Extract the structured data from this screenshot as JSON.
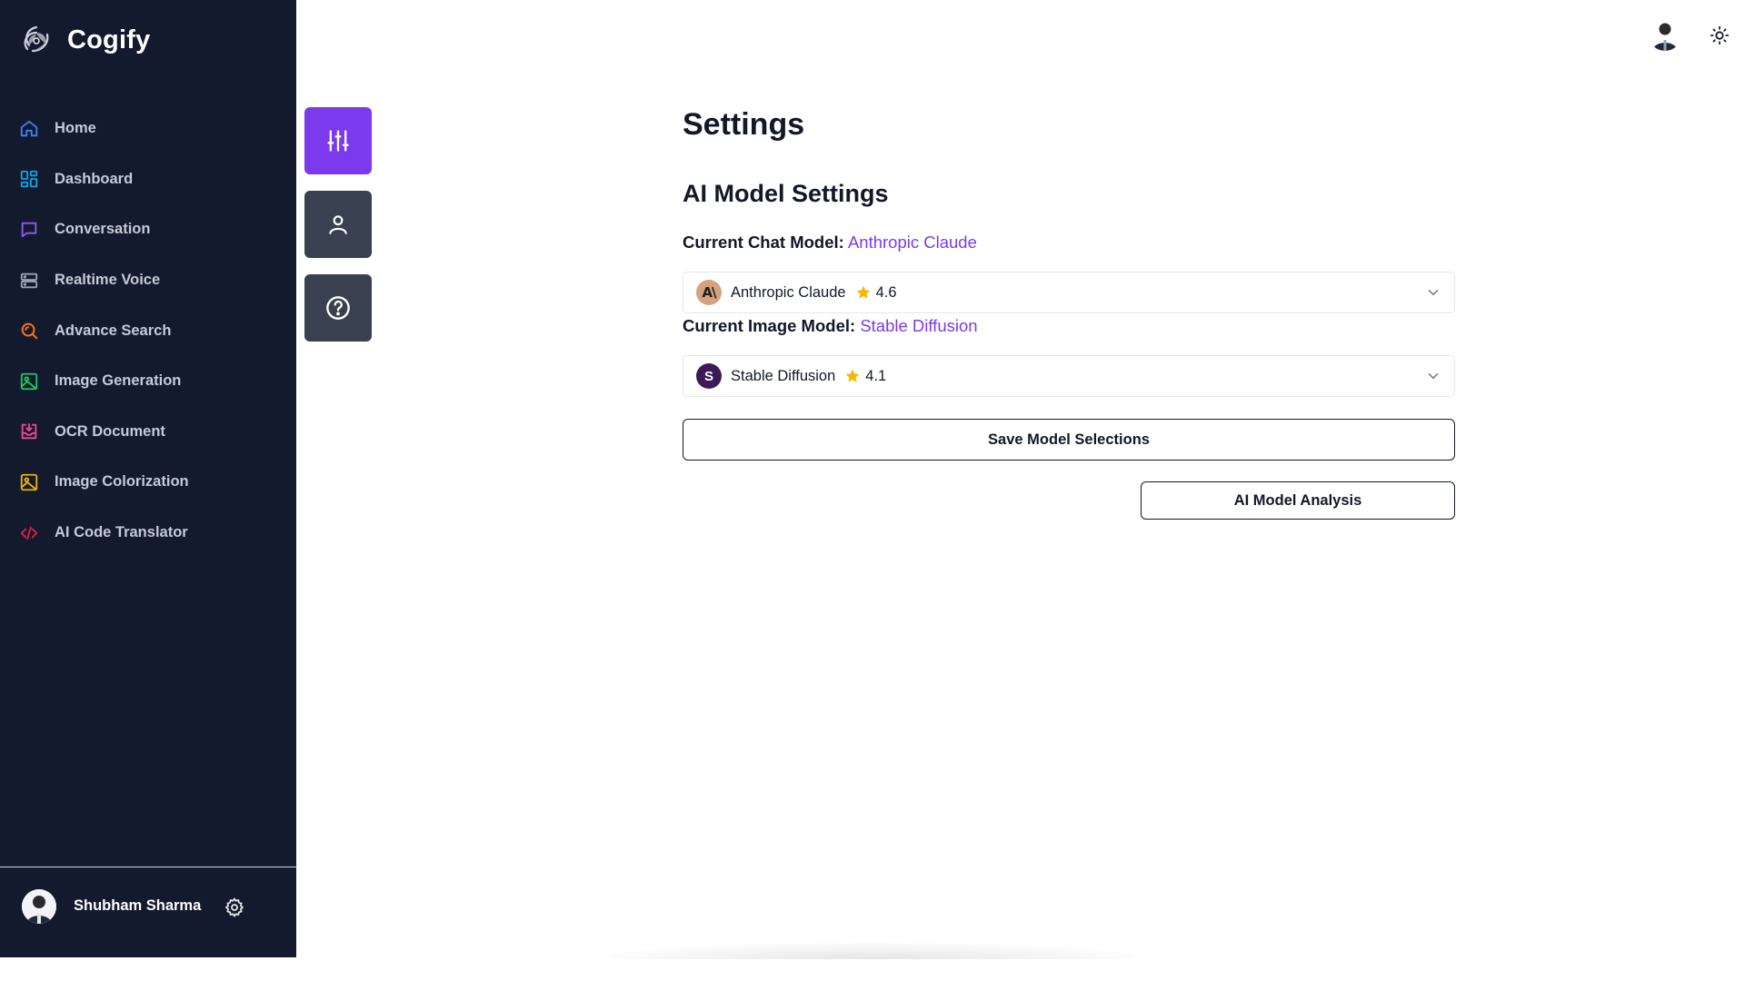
{
  "app": {
    "name": "Cogify"
  },
  "sidebar": {
    "items": [
      {
        "label": "Home",
        "icon": "home-icon",
        "color": "#3b82f6"
      },
      {
        "label": "Dashboard",
        "icon": "dashboard-icon",
        "color": "#0ea5e9"
      },
      {
        "label": "Conversation",
        "icon": "chat-icon",
        "color": "#8b5cf6"
      },
      {
        "label": "Realtime Voice",
        "icon": "server-icon",
        "color": "#9ca3af"
      },
      {
        "label": "Advance Search",
        "icon": "search-icon",
        "color": "#f97316"
      },
      {
        "label": "Image Generation",
        "icon": "image-icon",
        "color": "#22c55e"
      },
      {
        "label": "OCR Document",
        "icon": "download-tray-icon",
        "color": "#ec4899"
      },
      {
        "label": "Image Colorization",
        "icon": "image-icon",
        "color": "#eab308"
      },
      {
        "label": "AI Code Translator",
        "icon": "code-icon",
        "color": "#e11d48"
      }
    ],
    "user": {
      "name": "Shubham Sharma"
    }
  },
  "subnav": [
    {
      "icon": "sliders-icon",
      "active": true
    },
    {
      "icon": "user-icon",
      "active": false
    },
    {
      "icon": "help-circle-icon",
      "active": false
    }
  ],
  "settings": {
    "title": "Settings",
    "section_title": "AI Model Settings",
    "chat_model": {
      "label": "Current Chat Model:",
      "value": "Anthropic Claude",
      "selected": {
        "name": "Anthropic Claude",
        "rating": "4.6",
        "logo_text": "A\\"
      }
    },
    "image_model": {
      "label": "Current Image Model:",
      "value": "Stable Diffusion",
      "selected": {
        "name": "Stable Diffusion",
        "rating": "4.1",
        "logo_text": "S"
      }
    },
    "save_label": "Save Model Selections",
    "analysis_label": "AI Model Analysis"
  },
  "colors": {
    "sidebar_bg": "#141a2e",
    "accent": "#7c3aed",
    "subnav_bg": "#394150",
    "star": "#f5b800"
  }
}
